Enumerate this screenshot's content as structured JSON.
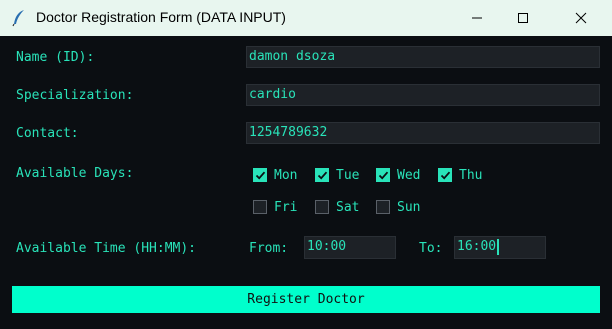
{
  "window": {
    "title": "Doctor Registration Form (DATA INPUT)"
  },
  "form": {
    "name_label": "Name (ID):",
    "name_value": "damon dsoza",
    "spec_label": "Specialization:",
    "spec_value": "cardio",
    "contact_label": "Contact:",
    "contact_value": "1254789632",
    "days_label": "Available Days:",
    "days": [
      {
        "label": "Mon",
        "checked": true
      },
      {
        "label": "Tue",
        "checked": true
      },
      {
        "label": "Wed",
        "checked": true
      },
      {
        "label": "Thu",
        "checked": true
      },
      {
        "label": "Fri",
        "checked": false
      },
      {
        "label": "Sat",
        "checked": false
      },
      {
        "label": "Sun",
        "checked": false
      }
    ],
    "time_label": "Available Time (HH:MM):",
    "from_label": "From:",
    "from_value": "10:00",
    "to_label": "To:",
    "to_value": "16:00",
    "submit_label": "Register Doctor"
  },
  "colors": {
    "background": "#0b0e12",
    "accent": "#29e3b9",
    "button": "#00ffcc",
    "field_bg": "#1d2126"
  }
}
